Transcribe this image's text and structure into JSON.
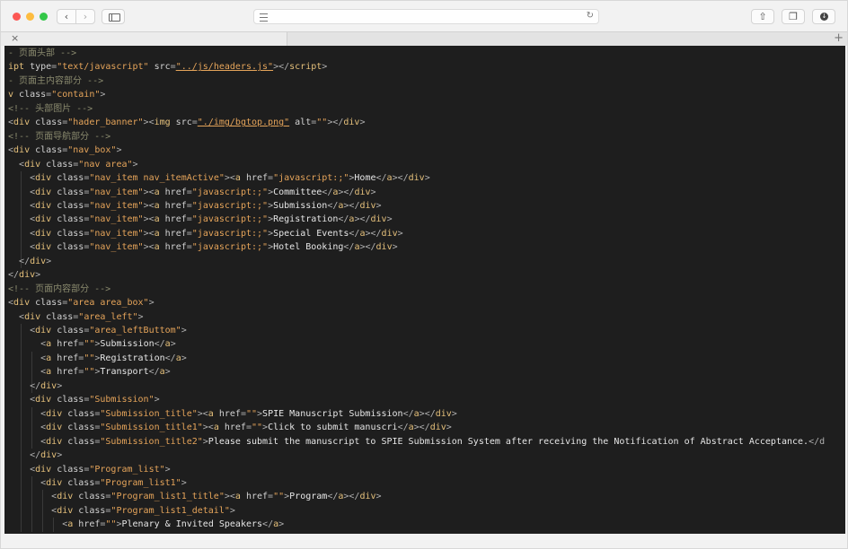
{
  "window": {
    "controls": [
      "close",
      "minimize",
      "zoom"
    ],
    "icons": {
      "back": "chevron-left-icon",
      "forward": "chevron-right-icon",
      "sidebar": "sidebar-icon",
      "reader": "reader-menu-icon",
      "reload": "reload-icon",
      "share": "share-icon",
      "tabs": "tabs-overview-icon",
      "downloads": "download-icon",
      "close_tab": "close-icon",
      "new_tab": "plus-icon"
    },
    "address": {
      "value": "",
      "placeholder": ""
    }
  },
  "theme": {
    "background": "#1e1e1e",
    "colors": {
      "comment": "#8a8a6e",
      "punct": "#b0b0b0",
      "tag": "#e5c07b",
      "attr": "#d2d2d2",
      "string": "#e5a45a",
      "text": "#e6e6e6"
    }
  },
  "code_lines": [
    [
      [
        "comment",
        "- 页面头部 -->"
      ]
    ],
    [
      [
        "tag",
        "ipt"
      ],
      [
        "attr",
        " type"
      ],
      [
        "punct",
        "="
      ],
      [
        "string",
        "\"text/javascript\""
      ],
      [
        "attr",
        " src"
      ],
      [
        "punct",
        "="
      ],
      [
        "string",
        "\"../js/headers.js\""
      ],
      [
        "punct",
        ">"
      ],
      [
        "punct",
        "</"
      ],
      [
        "tag",
        "script"
      ],
      [
        "punct",
        ">"
      ]
    ],
    [
      [
        "comment",
        "- 页面主内容部分 -->"
      ]
    ],
    [
      [
        "tag",
        "v"
      ],
      [
        "attr",
        " class"
      ],
      [
        "punct",
        "="
      ],
      [
        "string",
        "\"contain\""
      ],
      [
        "punct",
        ">"
      ]
    ],
    [
      [
        "comment",
        "<!-- 头部图片 -->"
      ]
    ],
    [
      [
        "punct",
        "<"
      ],
      [
        "tag",
        "div"
      ],
      [
        "attr",
        " class"
      ],
      [
        "punct",
        "="
      ],
      [
        "string",
        "\"hader_banner\""
      ],
      [
        "punct",
        "><"
      ],
      [
        "tag",
        "img"
      ],
      [
        "attr",
        " src"
      ],
      [
        "punct",
        "="
      ],
      [
        "string",
        "\"./img/bgtop.png\""
      ],
      [
        "attr",
        " alt"
      ],
      [
        "punct",
        "="
      ],
      [
        "string",
        "\"\""
      ],
      [
        "punct",
        "></"
      ],
      [
        "tag",
        "div"
      ],
      [
        "punct",
        ">"
      ]
    ],
    [
      [
        "comment",
        "<!-- 页面导航部分 -->"
      ]
    ],
    [
      [
        "punct",
        "<"
      ],
      [
        "tag",
        "div"
      ],
      [
        "attr",
        " class"
      ],
      [
        "punct",
        "="
      ],
      [
        "string",
        "\"nav_box\""
      ],
      [
        "punct",
        ">"
      ]
    ],
    [
      [
        "text",
        "  "
      ],
      [
        "punct",
        "<"
      ],
      [
        "tag",
        "div"
      ],
      [
        "attr",
        " class"
      ],
      [
        "punct",
        "="
      ],
      [
        "string",
        "\"nav area\""
      ],
      [
        "punct",
        ">"
      ]
    ],
    [
      [
        "text",
        "    "
      ],
      [
        "punct",
        "<"
      ],
      [
        "tag",
        "div"
      ],
      [
        "attr",
        " class"
      ],
      [
        "punct",
        "="
      ],
      [
        "string",
        "\"nav_item nav_itemActive\""
      ],
      [
        "punct",
        "><"
      ],
      [
        "tag",
        "a"
      ],
      [
        "attr",
        " href"
      ],
      [
        "punct",
        "="
      ],
      [
        "string",
        "\"javascript:;\""
      ],
      [
        "punct",
        ">"
      ],
      [
        "text",
        "Home"
      ],
      [
        "punct",
        "</"
      ],
      [
        "tag",
        "a"
      ],
      [
        "punct",
        "></"
      ],
      [
        "tag",
        "div"
      ],
      [
        "punct",
        ">"
      ]
    ],
    [
      [
        "text",
        "    "
      ],
      [
        "punct",
        "<"
      ],
      [
        "tag",
        "div"
      ],
      [
        "attr",
        " class"
      ],
      [
        "punct",
        "="
      ],
      [
        "string",
        "\"nav_item\""
      ],
      [
        "punct",
        "><"
      ],
      [
        "tag",
        "a"
      ],
      [
        "attr",
        " href"
      ],
      [
        "punct",
        "="
      ],
      [
        "string",
        "\"javascript:;\""
      ],
      [
        "punct",
        ">"
      ],
      [
        "text",
        "Committee"
      ],
      [
        "punct",
        "</"
      ],
      [
        "tag",
        "a"
      ],
      [
        "punct",
        "></"
      ],
      [
        "tag",
        "div"
      ],
      [
        "punct",
        ">"
      ]
    ],
    [
      [
        "text",
        "    "
      ],
      [
        "punct",
        "<"
      ],
      [
        "tag",
        "div"
      ],
      [
        "attr",
        " class"
      ],
      [
        "punct",
        "="
      ],
      [
        "string",
        "\"nav_item\""
      ],
      [
        "punct",
        "><"
      ],
      [
        "tag",
        "a"
      ],
      [
        "attr",
        " href"
      ],
      [
        "punct",
        "="
      ],
      [
        "string",
        "\"javascript:;\""
      ],
      [
        "punct",
        ">"
      ],
      [
        "text",
        "Submission"
      ],
      [
        "punct",
        "</"
      ],
      [
        "tag",
        "a"
      ],
      [
        "punct",
        "></"
      ],
      [
        "tag",
        "div"
      ],
      [
        "punct",
        ">"
      ]
    ],
    [
      [
        "text",
        "    "
      ],
      [
        "punct",
        "<"
      ],
      [
        "tag",
        "div"
      ],
      [
        "attr",
        " class"
      ],
      [
        "punct",
        "="
      ],
      [
        "string",
        "\"nav_item\""
      ],
      [
        "punct",
        "><"
      ],
      [
        "tag",
        "a"
      ],
      [
        "attr",
        " href"
      ],
      [
        "punct",
        "="
      ],
      [
        "string",
        "\"javascript:;\""
      ],
      [
        "punct",
        ">"
      ],
      [
        "text",
        "Registration"
      ],
      [
        "punct",
        "</"
      ],
      [
        "tag",
        "a"
      ],
      [
        "punct",
        "></"
      ],
      [
        "tag",
        "div"
      ],
      [
        "punct",
        ">"
      ]
    ],
    [
      [
        "text",
        "    "
      ],
      [
        "punct",
        "<"
      ],
      [
        "tag",
        "div"
      ],
      [
        "attr",
        " class"
      ],
      [
        "punct",
        "="
      ],
      [
        "string",
        "\"nav_item\""
      ],
      [
        "punct",
        "><"
      ],
      [
        "tag",
        "a"
      ],
      [
        "attr",
        " href"
      ],
      [
        "punct",
        "="
      ],
      [
        "string",
        "\"javascript:;\""
      ],
      [
        "punct",
        ">"
      ],
      [
        "text",
        "Special Events"
      ],
      [
        "punct",
        "</"
      ],
      [
        "tag",
        "a"
      ],
      [
        "punct",
        "></"
      ],
      [
        "tag",
        "div"
      ],
      [
        "punct",
        ">"
      ]
    ],
    [
      [
        "text",
        "    "
      ],
      [
        "punct",
        "<"
      ],
      [
        "tag",
        "div"
      ],
      [
        "attr",
        " class"
      ],
      [
        "punct",
        "="
      ],
      [
        "string",
        "\"nav_item\""
      ],
      [
        "punct",
        "><"
      ],
      [
        "tag",
        "a"
      ],
      [
        "attr",
        " href"
      ],
      [
        "punct",
        "="
      ],
      [
        "string",
        "\"javascript:;\""
      ],
      [
        "punct",
        ">"
      ],
      [
        "text",
        "Hotel Booking"
      ],
      [
        "punct",
        "</"
      ],
      [
        "tag",
        "a"
      ],
      [
        "punct",
        "></"
      ],
      [
        "tag",
        "div"
      ],
      [
        "punct",
        ">"
      ]
    ],
    [
      [
        "text",
        "  "
      ],
      [
        "punct",
        "</"
      ],
      [
        "tag",
        "div"
      ],
      [
        "punct",
        ">"
      ]
    ],
    [
      [
        "punct",
        "</"
      ],
      [
        "tag",
        "div"
      ],
      [
        "punct",
        ">"
      ]
    ],
    [
      [
        "comment",
        "<!-- 页面内容部分 -->"
      ]
    ],
    [
      [
        "punct",
        "<"
      ],
      [
        "tag",
        "div"
      ],
      [
        "attr",
        " class"
      ],
      [
        "punct",
        "="
      ],
      [
        "string",
        "\"area area_box\""
      ],
      [
        "punct",
        ">"
      ]
    ],
    [
      [
        "text",
        "  "
      ],
      [
        "punct",
        "<"
      ],
      [
        "tag",
        "div"
      ],
      [
        "attr",
        " class"
      ],
      [
        "punct",
        "="
      ],
      [
        "string",
        "\"area_left\""
      ],
      [
        "punct",
        ">"
      ]
    ],
    [
      [
        "text",
        "    "
      ],
      [
        "punct",
        "<"
      ],
      [
        "tag",
        "div"
      ],
      [
        "attr",
        " class"
      ],
      [
        "punct",
        "="
      ],
      [
        "string",
        "\"area_leftButtom\""
      ],
      [
        "punct",
        ">"
      ]
    ],
    [
      [
        "text",
        "      "
      ],
      [
        "punct",
        "<"
      ],
      [
        "tag",
        "a"
      ],
      [
        "attr",
        " href"
      ],
      [
        "punct",
        "="
      ],
      [
        "string",
        "\"\""
      ],
      [
        "punct",
        ">"
      ],
      [
        "text",
        "Submission"
      ],
      [
        "punct",
        "</"
      ],
      [
        "tag",
        "a"
      ],
      [
        "punct",
        ">"
      ]
    ],
    [
      [
        "text",
        "      "
      ],
      [
        "punct",
        "<"
      ],
      [
        "tag",
        "a"
      ],
      [
        "attr",
        " href"
      ],
      [
        "punct",
        "="
      ],
      [
        "string",
        "\"\""
      ],
      [
        "punct",
        ">"
      ],
      [
        "text",
        "Registration"
      ],
      [
        "punct",
        "</"
      ],
      [
        "tag",
        "a"
      ],
      [
        "punct",
        ">"
      ]
    ],
    [
      [
        "text",
        "      "
      ],
      [
        "punct",
        "<"
      ],
      [
        "tag",
        "a"
      ],
      [
        "attr",
        " href"
      ],
      [
        "punct",
        "="
      ],
      [
        "string",
        "\"\""
      ],
      [
        "punct",
        ">"
      ],
      [
        "text",
        "Transport"
      ],
      [
        "punct",
        "</"
      ],
      [
        "tag",
        "a"
      ],
      [
        "punct",
        ">"
      ]
    ],
    [
      [
        "text",
        "    "
      ],
      [
        "punct",
        "</"
      ],
      [
        "tag",
        "div"
      ],
      [
        "punct",
        ">"
      ]
    ],
    [
      [
        "text",
        "    "
      ],
      [
        "punct",
        "<"
      ],
      [
        "tag",
        "div"
      ],
      [
        "attr",
        " class"
      ],
      [
        "punct",
        "="
      ],
      [
        "string",
        "\"Submission\""
      ],
      [
        "punct",
        ">"
      ]
    ],
    [
      [
        "text",
        "      "
      ],
      [
        "punct",
        "<"
      ],
      [
        "tag",
        "div"
      ],
      [
        "attr",
        " class"
      ],
      [
        "punct",
        "="
      ],
      [
        "string",
        "\"Submission_title\""
      ],
      [
        "punct",
        "><"
      ],
      [
        "tag",
        "a"
      ],
      [
        "attr",
        " href"
      ],
      [
        "punct",
        "="
      ],
      [
        "string",
        "\"\""
      ],
      [
        "punct",
        ">"
      ],
      [
        "text",
        "SPIE Manuscript Submission"
      ],
      [
        "punct",
        "</"
      ],
      [
        "tag",
        "a"
      ],
      [
        "punct",
        "></"
      ],
      [
        "tag",
        "div"
      ],
      [
        "punct",
        ">"
      ]
    ],
    [
      [
        "text",
        "      "
      ],
      [
        "punct",
        "<"
      ],
      [
        "tag",
        "div"
      ],
      [
        "attr",
        " class"
      ],
      [
        "punct",
        "="
      ],
      [
        "string",
        "\"Submission_title1\""
      ],
      [
        "punct",
        "><"
      ],
      [
        "tag",
        "a"
      ],
      [
        "attr",
        " href"
      ],
      [
        "punct",
        "="
      ],
      [
        "string",
        "\"\""
      ],
      [
        "punct",
        ">"
      ],
      [
        "text",
        "Click to submit manuscri"
      ],
      [
        "punct",
        "</"
      ],
      [
        "tag",
        "a"
      ],
      [
        "punct",
        "></"
      ],
      [
        "tag",
        "div"
      ],
      [
        "punct",
        ">"
      ]
    ],
    [
      [
        "text",
        "      "
      ],
      [
        "punct",
        "<"
      ],
      [
        "tag",
        "div"
      ],
      [
        "attr",
        " class"
      ],
      [
        "punct",
        "="
      ],
      [
        "string",
        "\"Submission_title2\""
      ],
      [
        "punct",
        ">"
      ],
      [
        "text",
        "Please submit the manuscript to SPIE Submission System after receiving the Notification of Abstract Acceptance."
      ],
      [
        "punct",
        "</d"
      ]
    ],
    [
      [
        "text",
        "    "
      ],
      [
        "punct",
        "</"
      ],
      [
        "tag",
        "div"
      ],
      [
        "punct",
        ">"
      ]
    ],
    [
      [
        "text",
        "    "
      ],
      [
        "punct",
        "<"
      ],
      [
        "tag",
        "div"
      ],
      [
        "attr",
        " class"
      ],
      [
        "punct",
        "="
      ],
      [
        "string",
        "\"Program_list\""
      ],
      [
        "punct",
        ">"
      ]
    ],
    [
      [
        "text",
        "      "
      ],
      [
        "punct",
        "<"
      ],
      [
        "tag",
        "div"
      ],
      [
        "attr",
        " class"
      ],
      [
        "punct",
        "="
      ],
      [
        "string",
        "\"Program_list1\""
      ],
      [
        "punct",
        ">"
      ]
    ],
    [
      [
        "text",
        "        "
      ],
      [
        "punct",
        "<"
      ],
      [
        "tag",
        "div"
      ],
      [
        "attr",
        " class"
      ],
      [
        "punct",
        "="
      ],
      [
        "string",
        "\"Program_list1_title\""
      ],
      [
        "punct",
        "><"
      ],
      [
        "tag",
        "a"
      ],
      [
        "attr",
        " href"
      ],
      [
        "punct",
        "="
      ],
      [
        "string",
        "\"\""
      ],
      [
        "punct",
        ">"
      ],
      [
        "text",
        "Program"
      ],
      [
        "punct",
        "</"
      ],
      [
        "tag",
        "a"
      ],
      [
        "punct",
        "></"
      ],
      [
        "tag",
        "div"
      ],
      [
        "punct",
        ">"
      ]
    ],
    [
      [
        "text",
        "        "
      ],
      [
        "punct",
        "<"
      ],
      [
        "tag",
        "div"
      ],
      [
        "attr",
        " class"
      ],
      [
        "punct",
        "="
      ],
      [
        "string",
        "\"Program_list1_detail\""
      ],
      [
        "punct",
        ">"
      ]
    ],
    [
      [
        "text",
        "          "
      ],
      [
        "punct",
        "<"
      ],
      [
        "tag",
        "a"
      ],
      [
        "attr",
        " href"
      ],
      [
        "punct",
        "="
      ],
      [
        "string",
        "\"\""
      ],
      [
        "punct",
        ">"
      ],
      [
        "text",
        "Plenary & Invited Speakers"
      ],
      [
        "punct",
        "</"
      ],
      [
        "tag",
        "a"
      ],
      [
        "punct",
        ">"
      ]
    ]
  ]
}
